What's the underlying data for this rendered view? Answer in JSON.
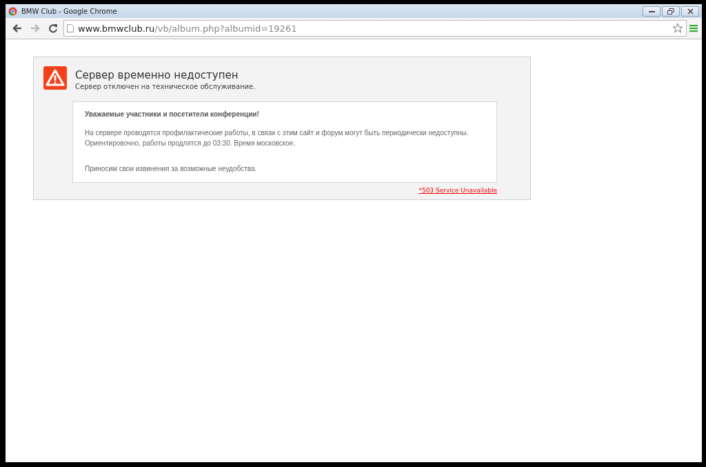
{
  "window": {
    "title": "BMW Club - Google Chrome"
  },
  "toolbar": {
    "nav_buttons": [
      {
        "kind": "back",
        "disabled": false
      },
      {
        "kind": "forward",
        "disabled": true
      },
      {
        "kind": "reload",
        "disabled": false
      }
    ],
    "url_host": "www.bmwclub.ru",
    "url_path": "/vb/album.php?albumid=19261"
  },
  "error_panel": {
    "title": "Сервер временно недоступен",
    "subtitle": "Сервер отключен на техническое обслуживание.",
    "message": {
      "heading": "Уважаемые участники и посетители конференции!",
      "paragraphs": [
        "На сервере проводятся профилактические работы, в связи с этим сайт и форум могут быть периодически недоступны. Ориентировочно, работы продлятся до 03:30. Время московское.",
        "Приносим свои извинения за возможные неудобства."
      ]
    },
    "status_link": "*503 Service Unavailable"
  }
}
